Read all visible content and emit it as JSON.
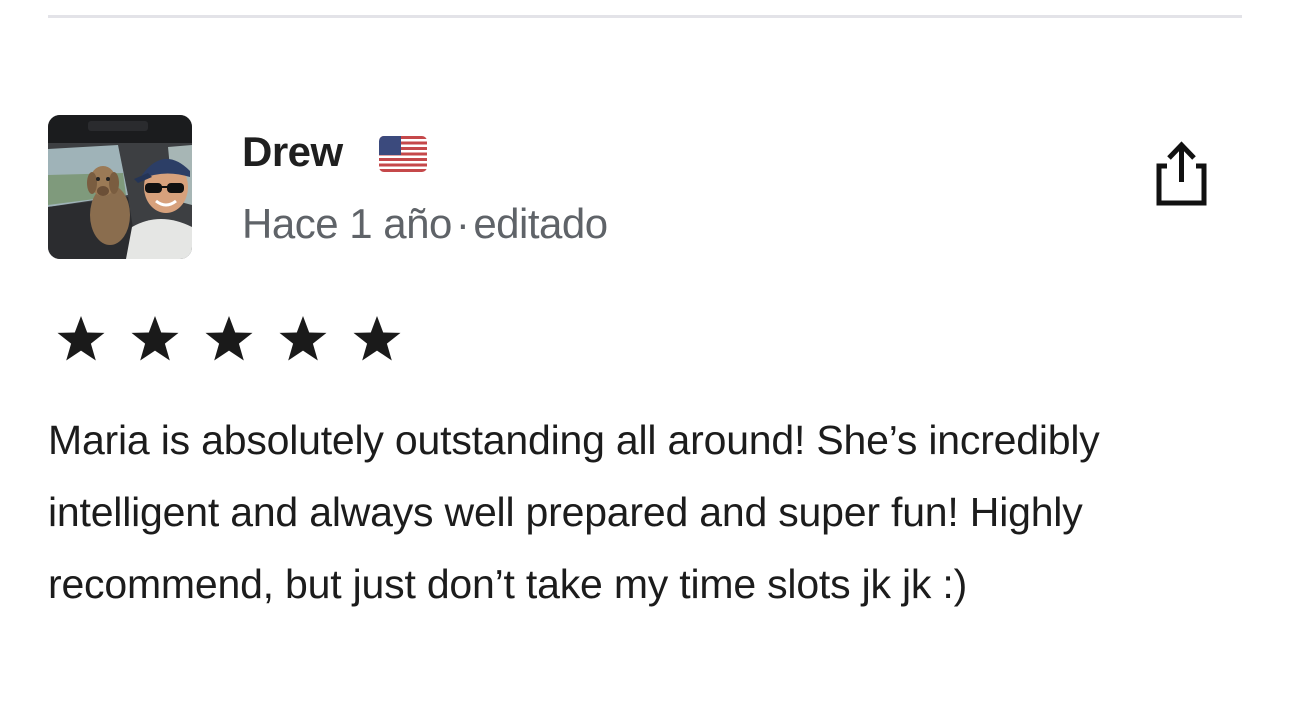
{
  "review": {
    "reviewer_name": "Drew",
    "reviewer_country_flag": "us-flag-icon",
    "time_ago": "Hace 1 año",
    "separator": "·",
    "edited_label": "editado",
    "rating": 5,
    "rating_max": 5,
    "text": "Maria is absolutely outstanding all around! She’s incredibly intelligent and always well prepared and super fun! Highly recommend, but just don’t take my time slots jk jk :)"
  },
  "icons": {
    "share": "share-icon",
    "star": "star-icon"
  },
  "colors": {
    "divider": "#e3e3e8",
    "name": "#1f1f1f",
    "meta": "#5f6368",
    "star": "#1a1a1a",
    "text": "#1c1c1c"
  }
}
